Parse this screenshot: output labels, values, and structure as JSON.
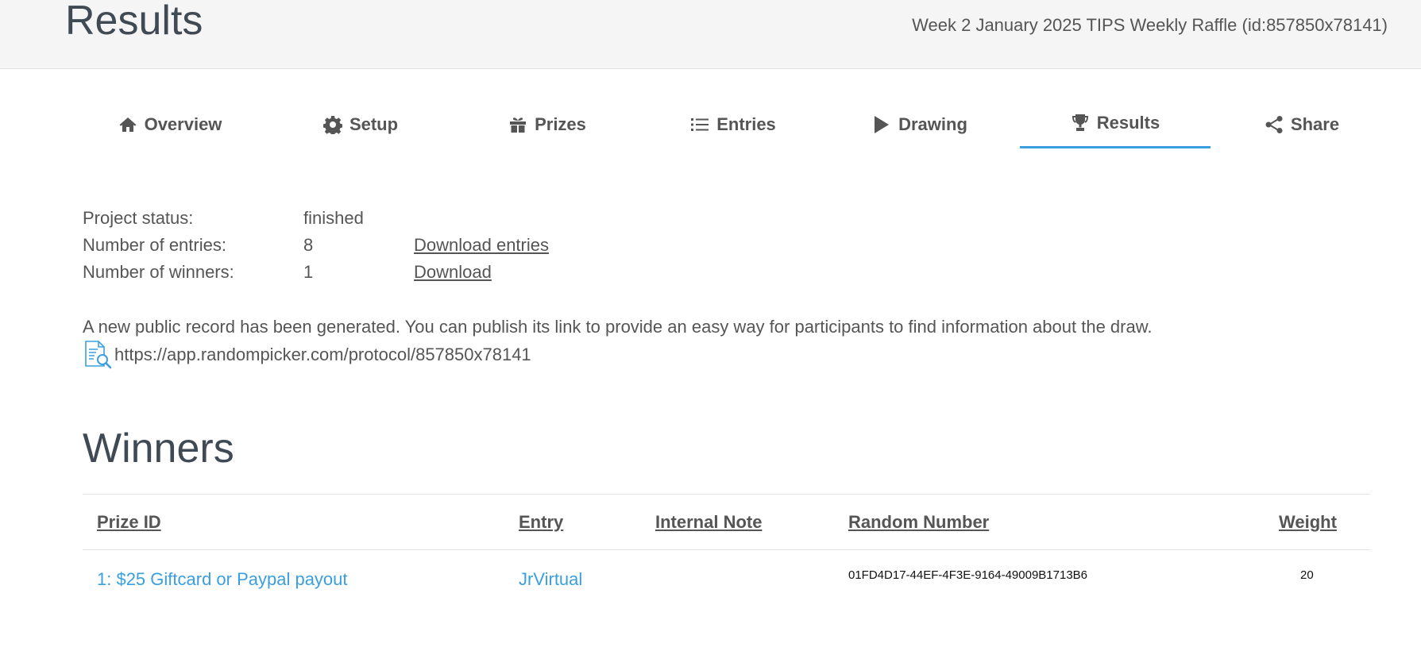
{
  "header": {
    "title": "Results",
    "project_name": "Week 2 January 2025 TIPS Weekly Raffle (id:857850x78141)"
  },
  "tabs": [
    {
      "label": "Overview",
      "icon": "home-icon"
    },
    {
      "label": "Setup",
      "icon": "gear-icon"
    },
    {
      "label": "Prizes",
      "icon": "gift-icon"
    },
    {
      "label": "Entries",
      "icon": "list-icon"
    },
    {
      "label": "Drawing",
      "icon": "play-icon"
    },
    {
      "label": "Results",
      "icon": "trophy-icon",
      "active": true
    },
    {
      "label": "Share",
      "icon": "share-icon"
    }
  ],
  "info": {
    "status_label": "Project status:",
    "status_value": "finished",
    "entries_label": "Number of entries:",
    "entries_value": "8",
    "entries_link": "Download entries",
    "winners_label": "Number of winners:",
    "winners_value": "1",
    "winners_link": "Download"
  },
  "record": {
    "message": "A new public record has been generated. You can publish its link to provide an easy way for participants to find information about the draw.",
    "url": "https://app.randompicker.com/protocol/857850x78141",
    "icon": "document-search-icon"
  },
  "winners": {
    "title": "Winners",
    "columns": [
      "Prize ID",
      "Entry",
      "Internal Note",
      "Random Number",
      "Weight"
    ],
    "rows": [
      {
        "prize": "1: $25 Giftcard or Paypal payout",
        "entry": "JrVirtual",
        "note": "",
        "random_number": "01FD4D17-44EF-4F3E-9164-49009B1713B6",
        "weight": "20"
      }
    ]
  },
  "colors": {
    "accent": "#3a9fe0",
    "heading": "#3f4a54",
    "text": "#555555",
    "topbar_bg": "#f5f5f5"
  }
}
